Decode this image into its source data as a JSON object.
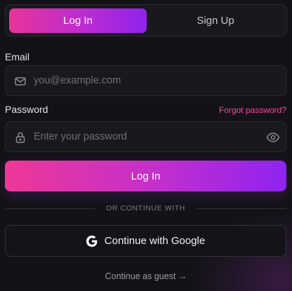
{
  "tabs": {
    "login": "Log In",
    "signup": "Sign Up"
  },
  "email": {
    "label": "Email",
    "placeholder": "you@example.com",
    "value": ""
  },
  "password": {
    "label": "Password",
    "placeholder": "Enter your password",
    "value": "",
    "forgot": "Forgot password?"
  },
  "submit_label": "Log In",
  "divider_text": "OR CONTINUE WITH",
  "google_label": "Continue with Google",
  "guest_label": "Continue as guest →",
  "colors": {
    "accent_start": "#ee3897",
    "accent_end": "#8f23f0",
    "link": "#ef4f9c",
    "background": "#131317"
  },
  "icons": {
    "email": "mail-icon",
    "password": "lock-icon",
    "toggle": "eye-icon",
    "google": "google-icon"
  }
}
